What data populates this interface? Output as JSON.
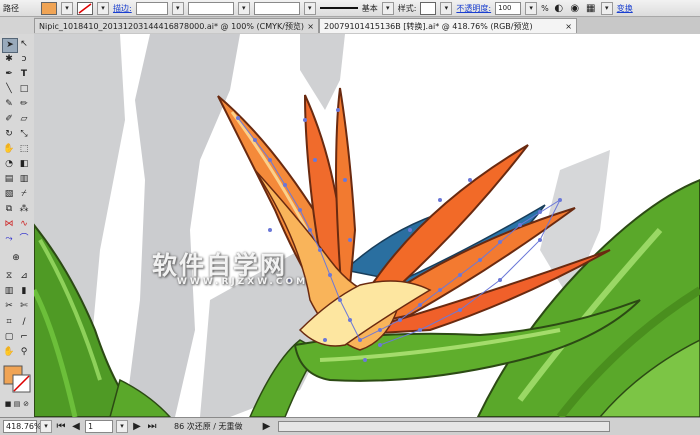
{
  "control_bar": {
    "object_type": "路径",
    "stroke_label": "描边:",
    "stroke_style": "基本",
    "style_label": "样式:",
    "opacity_label": "不透明度:",
    "opacity_value": "100",
    "opacity_unit": "%",
    "transform_label": "变换"
  },
  "tabs": [
    {
      "label": "Nipic_1018410_20131203144416878000.ai* @ 100% (CMYK/预览)",
      "close": "×"
    },
    {
      "label": "20079101415136B [转换].ai* @ 418.76% (RGB/预览)",
      "close": "×"
    }
  ],
  "status_bar": {
    "zoom": "418.76%",
    "artboard": "1",
    "history": "86 次还原 / 无重做"
  },
  "watermark": {
    "text": "软件自学网",
    "url": "WWW.RJZXW.COM"
  },
  "colors": {
    "fill": "#f0a455",
    "stroke": "#ffffff",
    "accent_link": "#1a3fd0",
    "leaf_green": "#5aa82a",
    "petal_orange": "#f07a2a",
    "petal_blue": "#2a6fa0",
    "anchor_blue": "#6b78d8"
  },
  "icons": [
    "selection-icon",
    "direct-selection-icon",
    "magic-wand-icon",
    "lasso-icon",
    "pen-icon",
    "type-icon",
    "line-icon",
    "rectangle-icon",
    "paintbrush-icon",
    "pencil-icon",
    "blob-brush-icon",
    "eraser-icon",
    "rotate-icon",
    "scale-icon",
    "warp-icon",
    "free-transform-icon",
    "symbol-sprayer-icon",
    "graph-icon",
    "mesh-icon",
    "gradient-icon",
    "eyedropper-icon",
    "blend-icon",
    "live-paint-icon",
    "live-paint-select-icon",
    "artboard-icon",
    "slice-icon",
    "hand-icon",
    "zoom-icon"
  ]
}
